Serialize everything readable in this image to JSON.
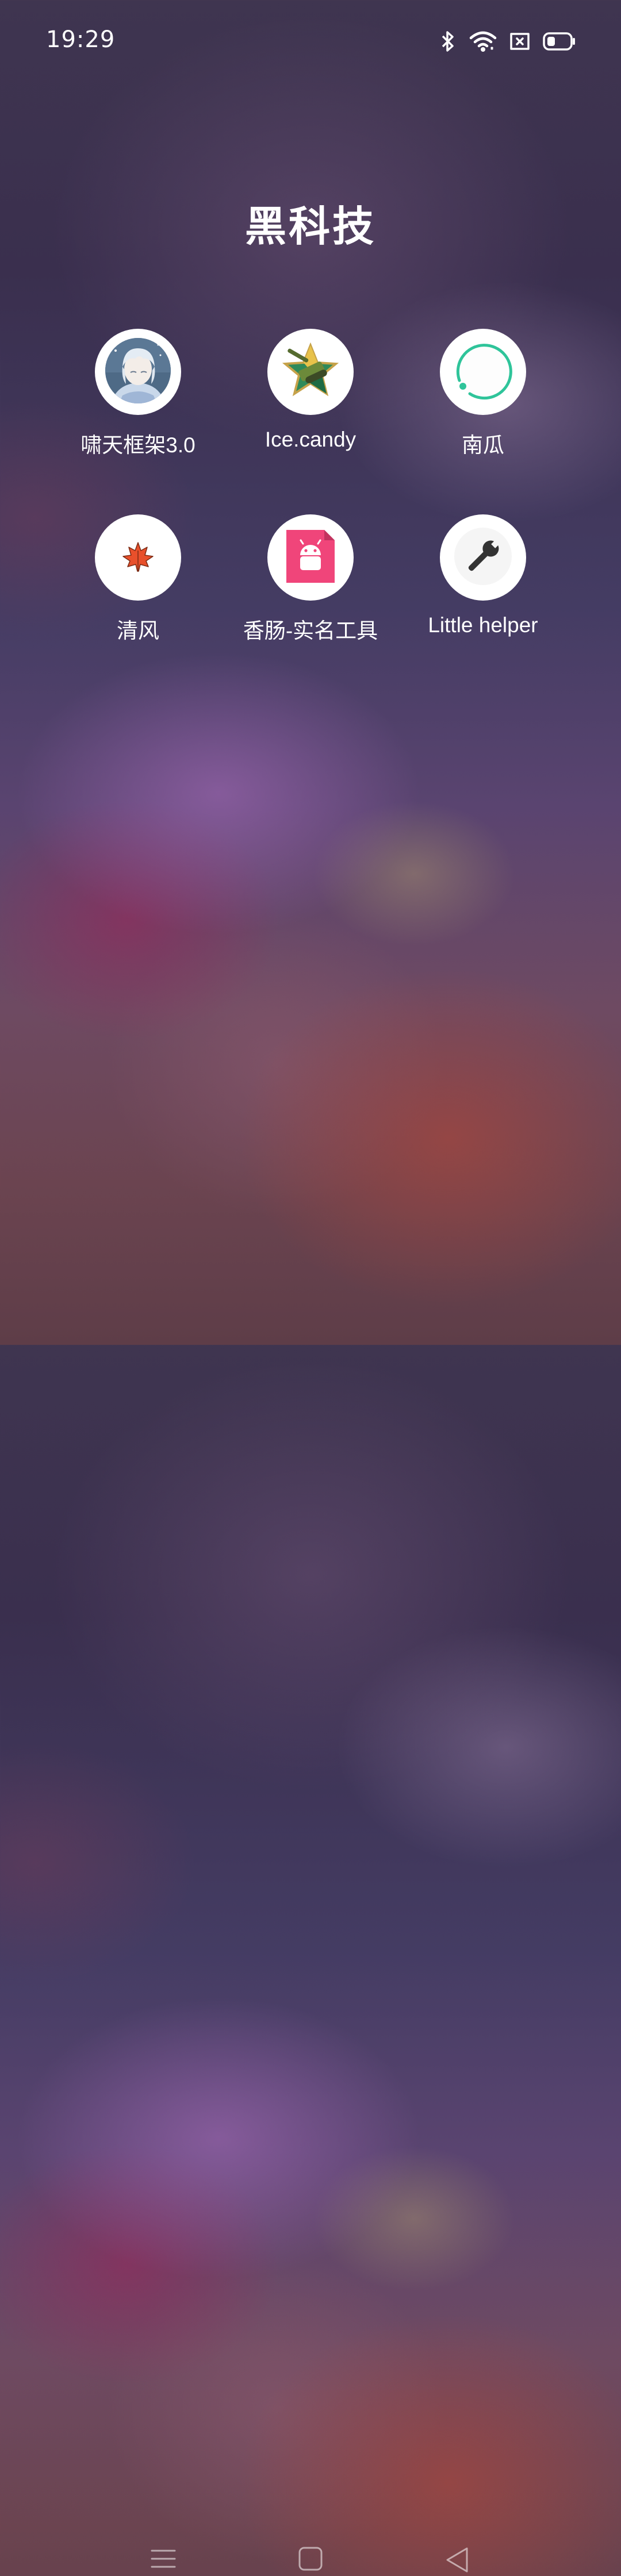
{
  "status_bar": {
    "time": "19:29",
    "icons": [
      "bluetooth-icon",
      "wifi-icon",
      "no-sim-icon",
      "battery-icon"
    ]
  },
  "folder": {
    "title": "黑科技",
    "apps": [
      {
        "label": "啸天框架3.0",
        "icon": "anime-avatar-icon"
      },
      {
        "label": "Ice.candy",
        "icon": "tank-star-icon"
      },
      {
        "label": "南瓜",
        "icon": "green-ring-icon"
      },
      {
        "label": "清风",
        "icon": "maple-leaf-icon"
      },
      {
        "label": "香肠-实名工具",
        "icon": "android-file-icon"
      },
      {
        "label": "Little helper",
        "icon": "wrench-icon"
      }
    ]
  },
  "navigation": {
    "buttons": [
      "menu-icon",
      "home-icon",
      "back-icon"
    ]
  },
  "colors": {
    "ring_accent": "#2fc49a",
    "android_pink": "#f0457a",
    "leaf_orange": "#e8502b"
  }
}
